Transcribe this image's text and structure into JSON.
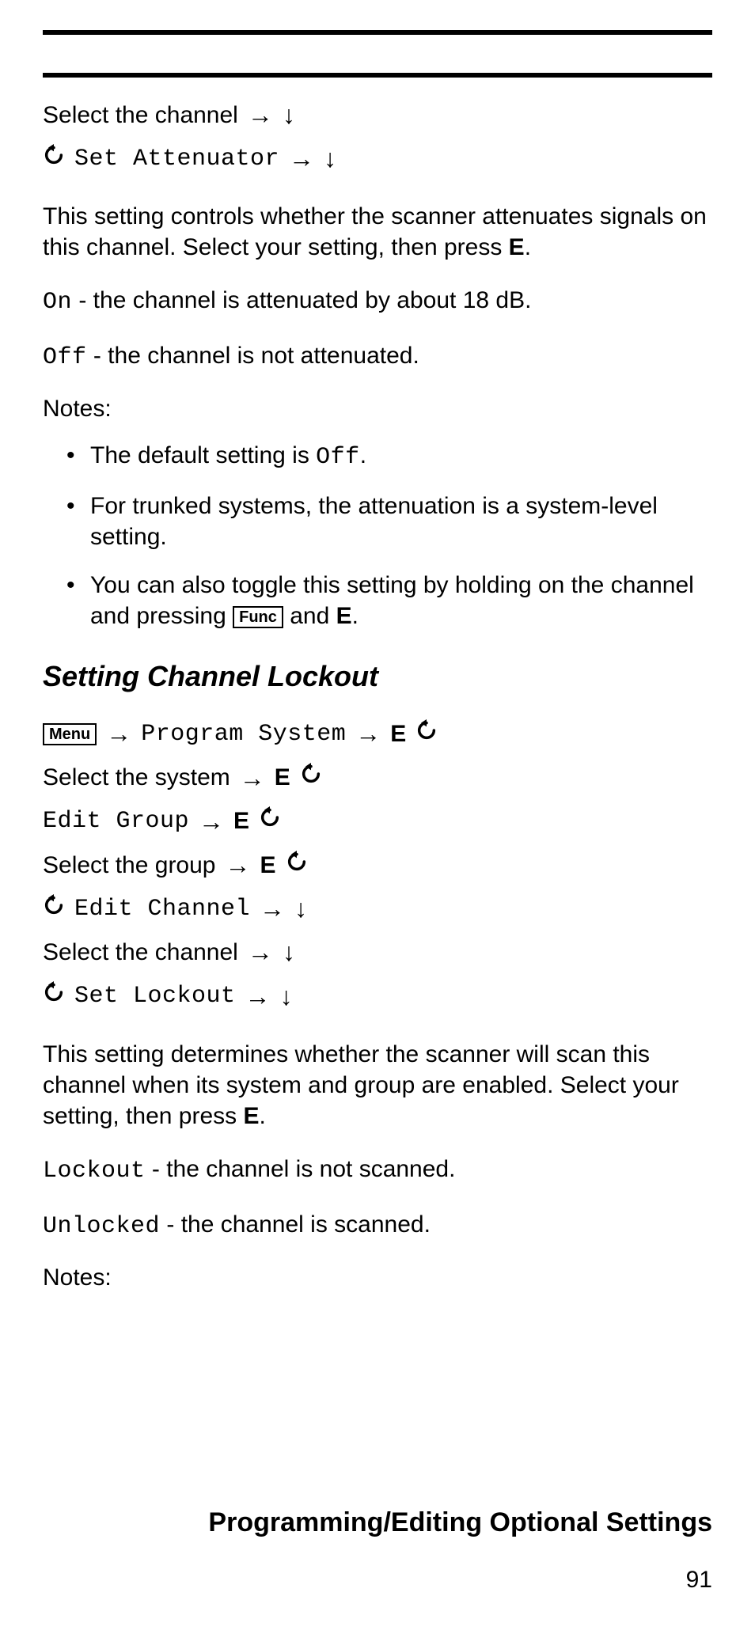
{
  "nav1": {
    "line1_text": "Select the channel",
    "line2_menu": "Set Attenuator"
  },
  "para1_a": "This setting controls whether the scanner attenuates signals on this channel. Select your setting, then press ",
  "para1_b": "E",
  "para1_c": ".",
  "opt_on_code": "On",
  "opt_on_text": " - the channel is attenuated by about 18 dB.",
  "opt_off_code": "Off",
  "opt_off_text": " - the channel is not attenuated.",
  "notes_label": "Notes:",
  "bullets1": {
    "b1_a": "The default setting is ",
    "b1_b": "Off",
    "b1_c": ".",
    "b2": "For trunked systems, the attenuation is a system-level setting.",
    "b3_a": "You can also toggle this setting by holding on the channel and pressing ",
    "b3_key": "Func",
    "b3_b": " and ",
    "b3_c": "E",
    "b3_d": "."
  },
  "heading": "Setting Channel Lockout",
  "nav2": {
    "menu_key": "Menu",
    "l1_menu": "Program System",
    "e": "E",
    "l2_text": "Select the system",
    "l3_menu": "Edit Group",
    "l4_text": "Select the group",
    "l5_menu": "Edit Channel",
    "l6_text": "Select the channel",
    "l7_menu": "Set Lockout"
  },
  "para2_a": "This setting determines whether the scanner will scan this channel when its system and group are enabled. Select your setting, then press ",
  "para2_b": "E",
  "para2_c": ".",
  "opt_lock_code": "Lockout",
  "opt_lock_text": " - the channel is not scanned.",
  "opt_unlock_code": "Unlocked",
  "opt_unlock_text": " - the channel is scanned.",
  "notes2_label": "Notes:",
  "footer_title": "Programming/Editing Optional Settings",
  "page_number": "91"
}
